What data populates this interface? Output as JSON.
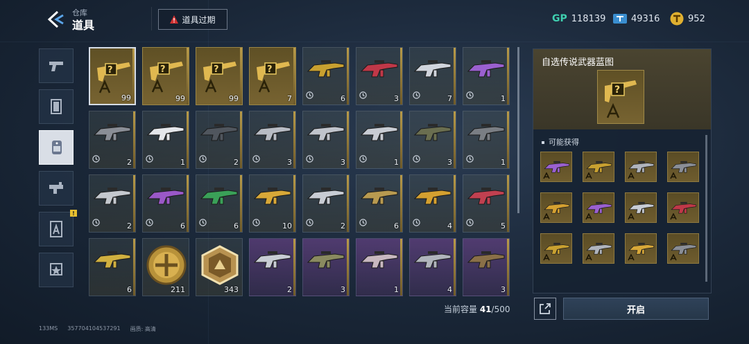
{
  "header": {
    "subtitle": "仓库",
    "title": "道具",
    "expired_button": "道具过期"
  },
  "currencies": [
    {
      "name": "gp-icon",
      "label": "GP",
      "value": "118139",
      "color": "#3fd0b0"
    },
    {
      "name": "ticket-icon",
      "label": "",
      "value": "49316",
      "color": "#4aa4e0"
    },
    {
      "name": "coin-icon",
      "label": "",
      "value": "952",
      "color": "#e0b030"
    }
  ],
  "sidebar": [
    {
      "name": "sidebar-weapons",
      "icon": "pistol-icon",
      "active": false,
      "alert": false
    },
    {
      "name": "sidebar-skins",
      "icon": "card-icon",
      "active": false,
      "alert": false
    },
    {
      "name": "sidebar-items",
      "icon": "dogtag-icon",
      "active": true,
      "alert": false
    },
    {
      "name": "sidebar-attachments",
      "icon": "weapon-part-icon",
      "active": false,
      "alert": false
    },
    {
      "name": "sidebar-blueprints",
      "icon": "blueprint-icon",
      "active": false,
      "alert": true
    },
    {
      "name": "sidebar-badges",
      "icon": "star-badge-icon",
      "active": false,
      "alert": false
    }
  ],
  "items": [
    {
      "kind": "blueprint",
      "qty": "99",
      "timed": false,
      "selected": true
    },
    {
      "kind": "blueprint",
      "qty": "99",
      "timed": false
    },
    {
      "kind": "blueprint",
      "qty": "99",
      "timed": false
    },
    {
      "kind": "blueprint",
      "qty": "7",
      "timed": false
    },
    {
      "kind": "weapon",
      "qty": "6",
      "timed": true,
      "color": "#c8a030"
    },
    {
      "kind": "weapon",
      "qty": "3",
      "timed": true,
      "color": "#c03848"
    },
    {
      "kind": "weapon",
      "qty": "7",
      "timed": true,
      "color": "#d0d4dc"
    },
    {
      "kind": "weapon",
      "qty": "1",
      "timed": true,
      "color": "#9a60d0"
    },
    {
      "kind": "weapon",
      "qty": "2",
      "timed": true,
      "color": "#8a8e96"
    },
    {
      "kind": "weapon",
      "qty": "1",
      "timed": true,
      "color": "#e4e6ea"
    },
    {
      "kind": "weapon",
      "qty": "2",
      "timed": true,
      "color": "#50565e"
    },
    {
      "kind": "weapon",
      "qty": "3",
      "timed": true,
      "color": "#b8bcc4"
    },
    {
      "kind": "weapon",
      "qty": "3",
      "timed": true,
      "color": "#c0c4cc"
    },
    {
      "kind": "weapon",
      "qty": "1",
      "timed": true,
      "color": "#c8ccd4"
    },
    {
      "kind": "weapon",
      "qty": "3",
      "timed": true,
      "color": "#6a6e50"
    },
    {
      "kind": "weapon",
      "qty": "1",
      "timed": true,
      "color": "#7a7e84"
    },
    {
      "kind": "weapon",
      "qty": "2",
      "timed": true,
      "color": "#c4c8ce"
    },
    {
      "kind": "weapon",
      "qty": "6",
      "timed": true,
      "color": "#9a58c8"
    },
    {
      "kind": "weapon",
      "qty": "6",
      "timed": true,
      "color": "#3aa058"
    },
    {
      "kind": "weapon",
      "qty": "10",
      "timed": true,
      "color": "#d8a838"
    },
    {
      "kind": "weapon",
      "qty": "2",
      "timed": true,
      "color": "#c8ccd4"
    },
    {
      "kind": "weapon",
      "qty": "6",
      "timed": true,
      "color": "#b89a50"
    },
    {
      "kind": "weapon",
      "qty": "4",
      "timed": true,
      "color": "#d4a030"
    },
    {
      "kind": "weapon",
      "qty": "5",
      "timed": true,
      "color": "#c04050"
    },
    {
      "kind": "weapon",
      "qty": "6",
      "timed": false,
      "color": "#d0b040"
    },
    {
      "kind": "gold-medal",
      "qty": "211",
      "timed": false
    },
    {
      "kind": "hex-medal",
      "qty": "343",
      "timed": false
    },
    {
      "kind": "weapon",
      "qty": "2",
      "timed": false,
      "purple": true,
      "color": "#c8ccd4"
    },
    {
      "kind": "weapon",
      "qty": "3",
      "timed": false,
      "purple": true,
      "color": "#8a8a60"
    },
    {
      "kind": "weapon",
      "qty": "1",
      "timed": false,
      "purple": true,
      "color": "#c8b8c0"
    },
    {
      "kind": "weapon",
      "qty": "4",
      "timed": false,
      "purple": true,
      "color": "#b0b4bc"
    },
    {
      "kind": "weapon",
      "qty": "3",
      "timed": false,
      "purple": true,
      "color": "#8a7048"
    }
  ],
  "capacity": {
    "label": "当前容量 ",
    "current": "41",
    "max": "/500"
  },
  "detail": {
    "title": "自选传说武器蓝图",
    "obtain_label": "可能获得",
    "rewards": [
      {
        "color": "#9a60d0"
      },
      {
        "color": "#c8a030"
      },
      {
        "color": "#b0b4bc"
      },
      {
        "color": "#8a8e96"
      },
      {
        "color": "#d4a030"
      },
      {
        "color": "#9a60d0"
      },
      {
        "color": "#c8ccd4"
      },
      {
        "color": "#c03848"
      },
      {
        "color": "#c8a030"
      },
      {
        "color": "#b0b4bc"
      },
      {
        "color": "#d8a838"
      },
      {
        "color": "#8a8e96"
      }
    ],
    "open_button": "开启"
  },
  "status_bar": {
    "ping": "133MS",
    "uid": "357704104537291",
    "quality": "画质: 高清"
  }
}
